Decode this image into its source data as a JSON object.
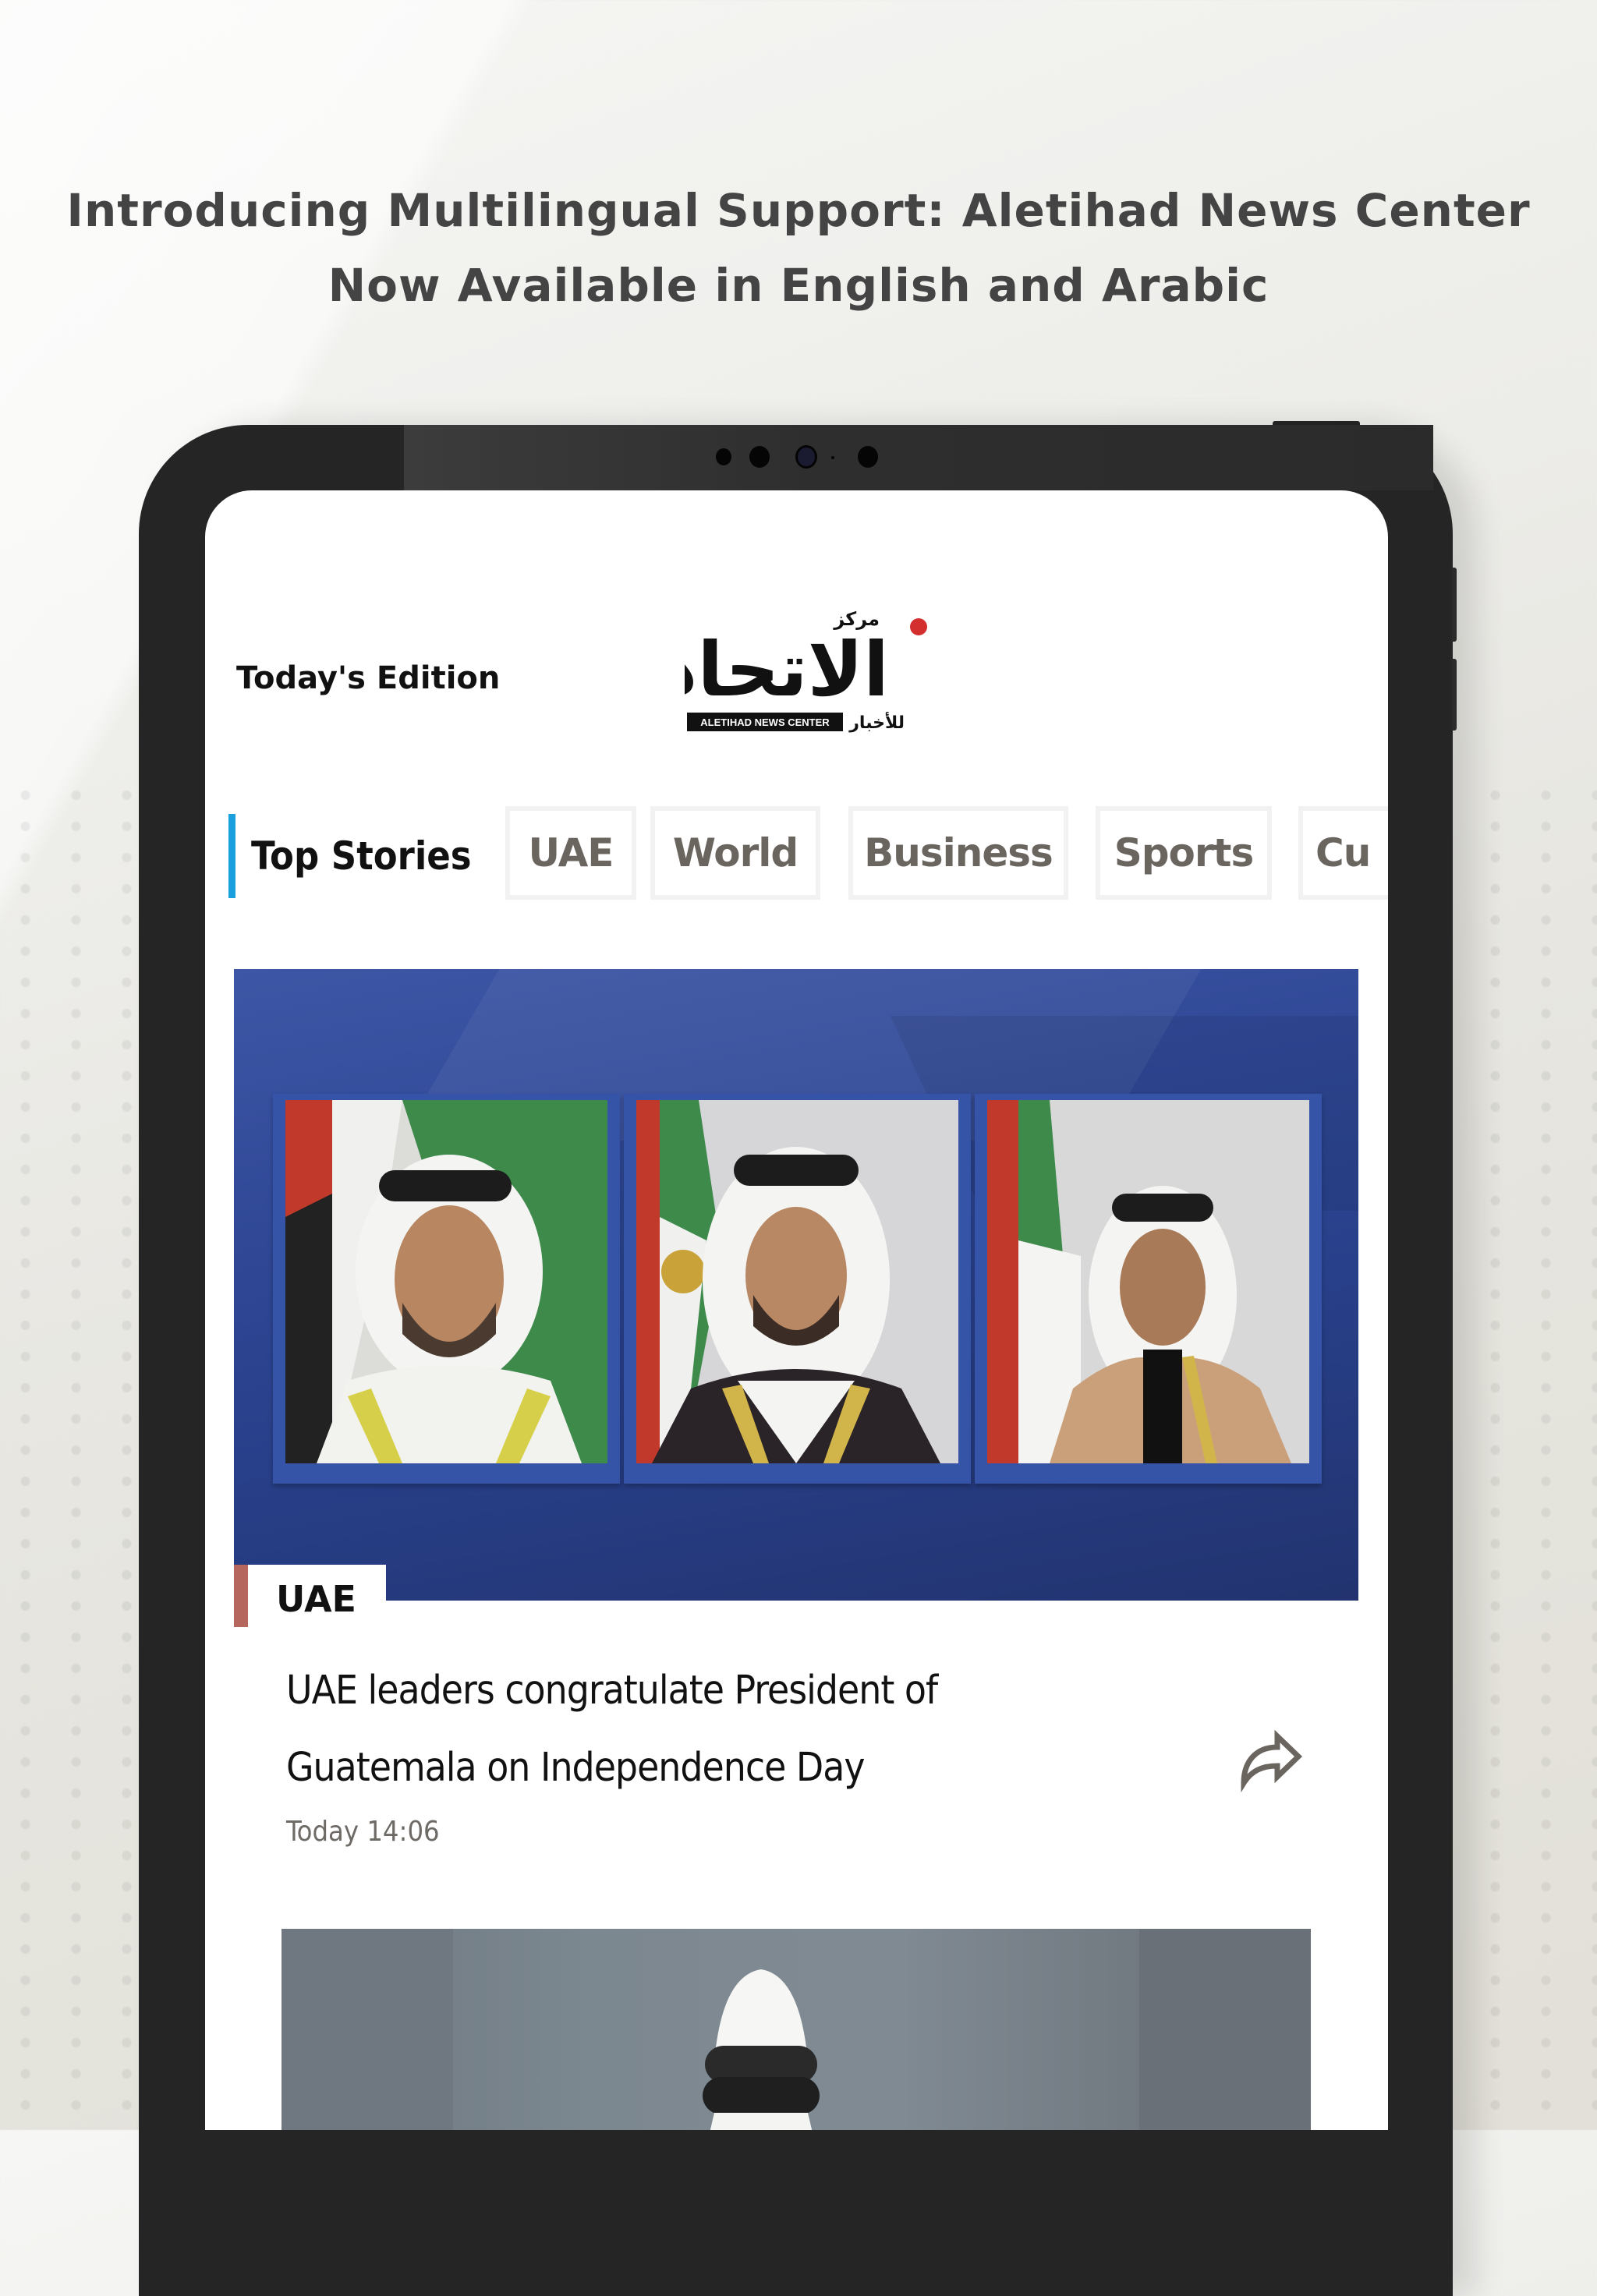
{
  "promo": {
    "headline_line1": "Introducing Multilingual Support: Aletihad News Center",
    "headline_line2": "Now Available in English and Arabic"
  },
  "app": {
    "edition_label": "Today's Edition",
    "logo": {
      "arabic_top": "مركز",
      "arabic_main": "الاتحاد",
      "arabic_sub": "للأخبار",
      "english_label": "ALETIHAD NEWS CENTER",
      "accent_dot_color": "#d32f2f"
    }
  },
  "tabs": {
    "active": {
      "label": "Top Stories",
      "indicator_color": "#1aa0dd"
    },
    "items": [
      {
        "label": "UAE"
      },
      {
        "label": "World"
      },
      {
        "label": "Business"
      },
      {
        "label": "Sports"
      },
      {
        "label": "Cu"
      }
    ]
  },
  "articles": [
    {
      "category": "UAE",
      "category_color": "#b5675d",
      "title_line1": "UAE leaders congratulate President of",
      "title_line2": "Guatemala on Independence Day",
      "time": "Today 14:06",
      "share_icon": "share-icon"
    }
  ],
  "colors": {
    "headline_text": "#444444",
    "tab_text": "#6b6560",
    "hero_background": "#2f4795",
    "tablet_bezel": "#252525"
  }
}
